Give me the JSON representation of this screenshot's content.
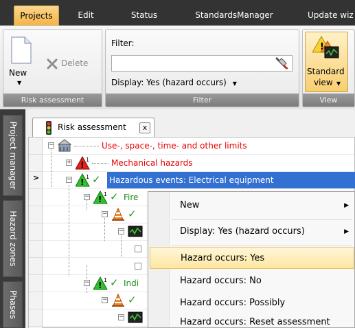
{
  "ribbon_tabs": [
    {
      "label": "Projects",
      "active": true
    },
    {
      "label": "Edit",
      "active": false
    },
    {
      "label": "Status",
      "active": false
    },
    {
      "label": "StandardsManager",
      "active": false
    },
    {
      "label": "Update wiz",
      "active": false
    }
  ],
  "risk_group": {
    "new_label": "New",
    "delete_label": "Delete",
    "caption": "Risk assessment"
  },
  "filter_group": {
    "filter_label": "Filter:",
    "filter_value": "",
    "display_label": "Display: Yes (hazard occurs)",
    "caption": "Filter"
  },
  "view_group": {
    "button_line1": "Standard",
    "button_line2": "view",
    "caption": "View"
  },
  "side_tabs": [
    "Project manager",
    "Hazard zones",
    "Phases"
  ],
  "document_tab": {
    "label": "Risk assessment",
    "close_glyph": "x"
  },
  "row_marker": ">",
  "tree": [
    {
      "label": "Use-, space-, time- and other limits"
    },
    {
      "label": "Mechanical hazards"
    },
    {
      "label": "Hazardous events: Electrical equipment"
    },
    {
      "label": "Fire"
    },
    {
      "label": "Indi"
    }
  ],
  "context_menu": [
    {
      "label": "New",
      "submenu": true
    },
    {
      "label": "Display: Yes (hazard occurs)",
      "submenu": true
    },
    {
      "label": "Hazard occurs: Yes",
      "submenu": false,
      "highlighted": true
    },
    {
      "label": "Hazard occurs: No",
      "submenu": false
    },
    {
      "label": "Hazard occurs: Possibly",
      "submenu": false
    },
    {
      "label": "Hazard occurs: Reset assessment",
      "submenu": false
    }
  ],
  "colors": {
    "accent_tab": "#f4b446",
    "selection": "#3271d1",
    "red_text": "#e60000",
    "green_text": "#1a8f1a",
    "menu_highlight": "#fde7a0"
  }
}
